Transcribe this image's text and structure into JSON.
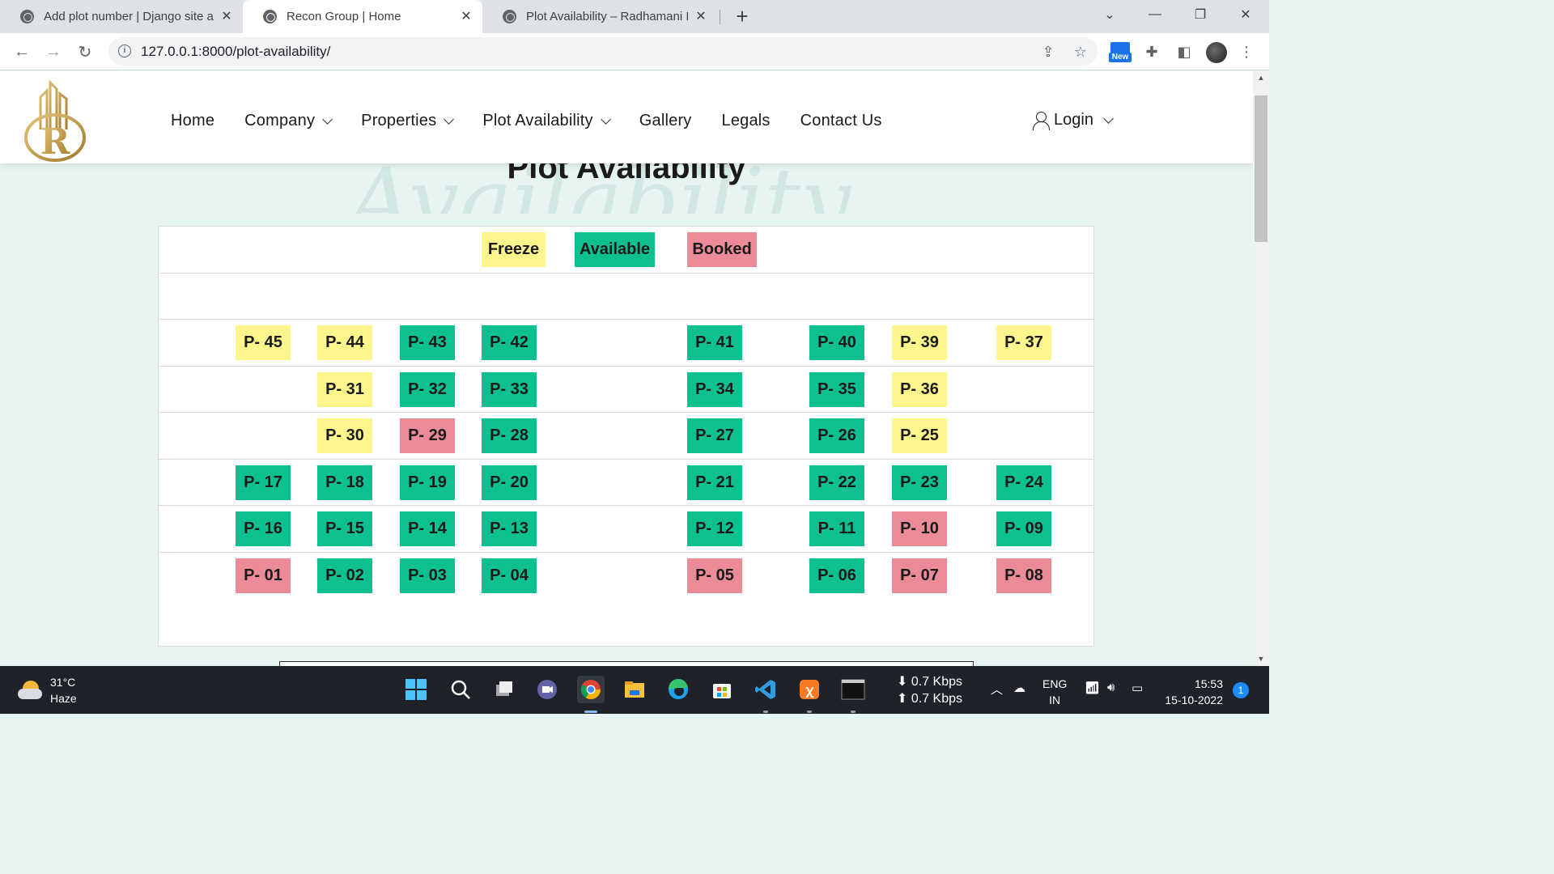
{
  "browser": {
    "tabs": [
      {
        "title": "Add plot number | Django site ad",
        "active": false
      },
      {
        "title": "Recon Group | Home",
        "active": true
      },
      {
        "title": "Plot Availability – Radhamani Infr",
        "active": false
      }
    ],
    "url": "127.0.0.1:8000/plot-availability/",
    "ext_new_label": "New"
  },
  "site": {
    "nav": [
      {
        "label": "Home",
        "dropdown": false
      },
      {
        "label": "Company",
        "dropdown": true
      },
      {
        "label": "Properties",
        "dropdown": true
      },
      {
        "label": "Plot Availability",
        "dropdown": true
      },
      {
        "label": "Gallery",
        "dropdown": false
      },
      {
        "label": "Legals",
        "dropdown": false
      },
      {
        "label": "Contact Us",
        "dropdown": false
      }
    ],
    "login_label": "Login",
    "heading": "Plot Availability",
    "heading_script": "Availability"
  },
  "legend": [
    {
      "label": "Freeze",
      "status": "freeze"
    },
    {
      "label": "Available",
      "status": "available"
    },
    {
      "label": "Booked",
      "status": "booked"
    }
  ],
  "colors": {
    "freeze": "#fdf68c",
    "available": "#0cc08f",
    "booked": "#ea8b97"
  },
  "plot_rows": [
    [
      {
        "label": "P- 45",
        "status": "freeze",
        "col": 0
      },
      {
        "label": "P- 44",
        "status": "freeze",
        "col": 1
      },
      {
        "label": "P- 43",
        "status": "available",
        "col": 2
      },
      {
        "label": "P- 42",
        "status": "available",
        "col": 3
      },
      {
        "label": "P- 41",
        "status": "available",
        "col": 4
      },
      {
        "label": "P- 40",
        "status": "available",
        "col": 5
      },
      {
        "label": "P- 39",
        "status": "freeze",
        "col": 6
      },
      {
        "label": "P- 37",
        "status": "freeze",
        "col": 7
      }
    ],
    [
      {
        "label": "P- 31",
        "status": "freeze",
        "col": 1
      },
      {
        "label": "P- 32",
        "status": "available",
        "col": 2
      },
      {
        "label": "P- 33",
        "status": "available",
        "col": 3
      },
      {
        "label": "P- 34",
        "status": "available",
        "col": 4
      },
      {
        "label": "P- 35",
        "status": "available",
        "col": 5
      },
      {
        "label": "P- 36",
        "status": "freeze",
        "col": 6
      }
    ],
    [
      {
        "label": "P- 30",
        "status": "freeze",
        "col": 1
      },
      {
        "label": "P- 29",
        "status": "booked",
        "col": 2
      },
      {
        "label": "P- 28",
        "status": "available",
        "col": 3
      },
      {
        "label": "P- 27",
        "status": "available",
        "col": 4
      },
      {
        "label": "P- 26",
        "status": "available",
        "col": 5
      },
      {
        "label": "P- 25",
        "status": "freeze",
        "col": 6
      }
    ],
    [
      {
        "label": "P- 17",
        "status": "available",
        "col": 0
      },
      {
        "label": "P- 18",
        "status": "available",
        "col": 1
      },
      {
        "label": "P- 19",
        "status": "available",
        "col": 2
      },
      {
        "label": "P- 20",
        "status": "available",
        "col": 3
      },
      {
        "label": "P- 21",
        "status": "available",
        "col": 4
      },
      {
        "label": "P- 22",
        "status": "available",
        "col": 5
      },
      {
        "label": "P- 23",
        "status": "available",
        "col": 6
      },
      {
        "label": "P- 24",
        "status": "available",
        "col": 7
      }
    ],
    [
      {
        "label": "P- 16",
        "status": "available",
        "col": 0
      },
      {
        "label": "P- 15",
        "status": "available",
        "col": 1
      },
      {
        "label": "P- 14",
        "status": "available",
        "col": 2
      },
      {
        "label": "P- 13",
        "status": "available",
        "col": 3
      },
      {
        "label": "P- 12",
        "status": "available",
        "col": 4
      },
      {
        "label": "P- 11",
        "status": "available",
        "col": 5
      },
      {
        "label": "P- 10",
        "status": "booked",
        "col": 6
      },
      {
        "label": "P- 09",
        "status": "available",
        "col": 7
      }
    ],
    [
      {
        "label": "P- 01",
        "status": "booked",
        "col": 0
      },
      {
        "label": "P- 02",
        "status": "available",
        "col": 1
      },
      {
        "label": "P- 03",
        "status": "available",
        "col": 2
      },
      {
        "label": "P- 04",
        "status": "available",
        "col": 3
      },
      {
        "label": "P- 05",
        "status": "booked",
        "col": 4
      },
      {
        "label": "P- 06",
        "status": "available",
        "col": 5
      },
      {
        "label": "P- 07",
        "status": "booked",
        "col": 6
      },
      {
        "label": "P- 08",
        "status": "booked",
        "col": 7
      }
    ]
  ],
  "taskbar": {
    "weather_temp": "31°C",
    "weather_desc": "Haze",
    "net_down": "⬇ 0.7 Kbps",
    "net_up": "⬆ 0.7 Kbps",
    "lang_1": "ENG",
    "lang_2": "IN",
    "time": "15:53",
    "date": "15-10-2022",
    "notifications": "1"
  }
}
